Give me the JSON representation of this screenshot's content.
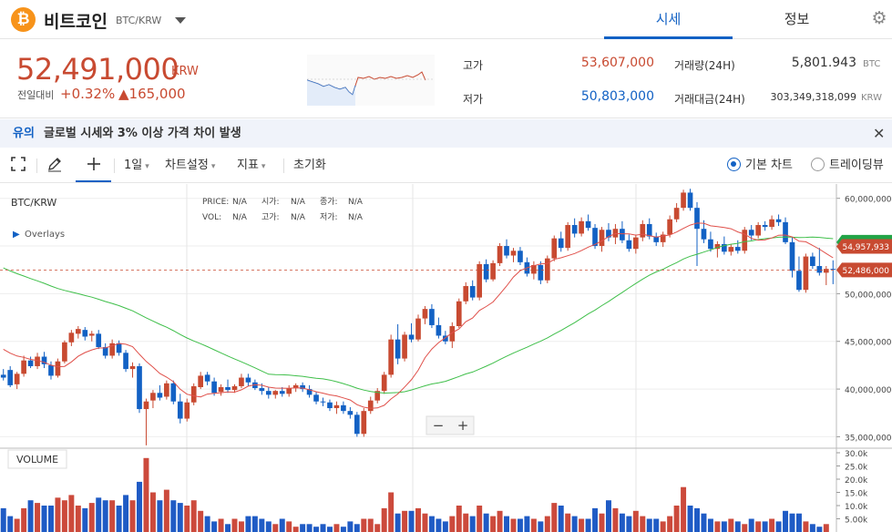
{
  "header": {
    "coin_symbol_glyph": "₿",
    "coin_name": "비트코인",
    "coin_pair": "BTC/KRW",
    "tabs": [
      {
        "label": "시세"
      },
      {
        "label": "정보"
      }
    ],
    "settings_icon": "gear-icon"
  },
  "price": {
    "current": "52,491,000",
    "unit": "KRW",
    "change_label": "전일대비",
    "change_rate": "+0.32%",
    "change_amount": "▲165,000"
  },
  "stats": {
    "high_label": "고가",
    "high_value": "53,607,000",
    "low_label": "저가",
    "low_value": "50,803,000",
    "volume_label": "거래량(24H)",
    "volume_value": "5,801.943",
    "volume_unit": "BTC",
    "amount_label": "거래대금(24H)",
    "amount_value": "303,349,318,099",
    "amount_unit": "KRW"
  },
  "notice": {
    "tag": "유의",
    "text": "글로벌 시세와 3% 이상 가격 차이 발생",
    "close_icon": "close-icon"
  },
  "toolbar": {
    "fullscreen_icon": "fullscreen-icon",
    "draw_icon": "pencil-icon",
    "crosshair_icon": "crosshair-icon",
    "interval": "1일",
    "chart_settings": "차트설정",
    "indicators": "지표",
    "reset": "초기화",
    "chart_type_basic": "기본 차트",
    "chart_type_tv": "트레이딩뷰"
  },
  "chart_data": {
    "type": "candlestick",
    "pair": "BTC/KRW",
    "overlays_label": "Overlays",
    "legend": {
      "price_label": "PRICE:",
      "price_value": "N/A",
      "open_label": "시가:",
      "open_value": "N/A",
      "close_label": "종가:",
      "close_value": "N/A",
      "vol_label": "VOL:",
      "vol_value": "N/A",
      "high_label": "고가:",
      "high_value": "N/A",
      "low_label": "저가:",
      "low_value": "N/A"
    },
    "ylim": [
      33800000,
      61500000
    ],
    "y_ticks": [
      {
        "value": 60000000,
        "label": "60,000,000"
      },
      {
        "value": 55000000,
        "label": "55,000,000"
      },
      {
        "value": 50000000,
        "label": "50,000,000"
      },
      {
        "value": 45000000,
        "label": "45,000,000"
      },
      {
        "value": 40000000,
        "label": "40,000,000"
      },
      {
        "value": 35000000,
        "label": "35,000,000"
      }
    ],
    "price_badges": [
      {
        "value": 54957933,
        "label": "54,957,933",
        "color": "#c84a31"
      },
      {
        "value": 52486000,
        "label": "52,486,000",
        "color": "#c84a31"
      },
      {
        "value": 55400000,
        "label": "",
        "color": "#22a447"
      }
    ],
    "current_price_line": 52486000,
    "candles": [
      [
        41.5,
        42.1,
        40.9,
        41.2
      ],
      [
        42.0,
        42.4,
        40.2,
        40.4
      ],
      [
        40.5,
        41.8,
        40.0,
        41.6
      ],
      [
        41.6,
        43.5,
        41.3,
        43.0
      ],
      [
        43.0,
        43.4,
        42.2,
        42.4
      ],
      [
        42.4,
        43.8,
        42.1,
        43.4
      ],
      [
        43.4,
        43.9,
        42.2,
        42.6
      ],
      [
        42.5,
        42.9,
        41.0,
        41.4
      ],
      [
        41.4,
        43.2,
        41.2,
        42.9
      ],
      [
        42.9,
        45.1,
        42.7,
        44.9
      ],
      [
        44.9,
        46.2,
        44.5,
        45.9
      ],
      [
        45.8,
        46.6,
        45.3,
        46.3
      ],
      [
        46.2,
        46.5,
        45.1,
        45.5
      ],
      [
        45.6,
        46.1,
        45.0,
        45.8
      ],
      [
        45.8,
        46.2,
        44.2,
        44.4
      ],
      [
        44.4,
        44.8,
        43.2,
        43.5
      ],
      [
        43.5,
        45.2,
        43.2,
        44.8
      ],
      [
        44.8,
        45.1,
        43.5,
        43.8
      ],
      [
        43.8,
        44.1,
        41.8,
        42.1
      ],
      [
        42.1,
        42.8,
        41.2,
        42.4
      ],
      [
        42.4,
        42.7,
        37.5,
        37.9
      ],
      [
        37.9,
        39.0,
        34.1,
        38.7
      ],
      [
        38.8,
        39.9,
        38.0,
        39.6
      ],
      [
        39.6,
        40.4,
        38.8,
        39.1
      ],
      [
        39.2,
        40.9,
        38.9,
        40.6
      ],
      [
        40.6,
        40.9,
        38.4,
        38.7
      ],
      [
        38.7,
        39.5,
        36.4,
        36.9
      ],
      [
        36.9,
        39.0,
        36.6,
        38.6
      ],
      [
        38.6,
        40.6,
        38.3,
        40.3
      ],
      [
        40.2,
        41.8,
        40.0,
        41.4
      ],
      [
        41.5,
        41.8,
        40.4,
        40.8
      ],
      [
        40.8,
        41.2,
        39.3,
        39.6
      ],
      [
        39.7,
        40.5,
        39.3,
        40.2
      ],
      [
        40.2,
        41.0,
        39.6,
        39.9
      ],
      [
        39.9,
        40.5,
        39.6,
        40.3
      ],
      [
        40.3,
        41.6,
        40.1,
        41.2
      ],
      [
        41.2,
        41.6,
        40.3,
        40.7
      ],
      [
        40.7,
        41.0,
        39.9,
        40.1
      ],
      [
        40.1,
        40.6,
        39.4,
        39.8
      ],
      [
        39.8,
        40.2,
        39.0,
        39.4
      ],
      [
        39.4,
        39.9,
        39.0,
        39.8
      ],
      [
        39.8,
        40.2,
        39.2,
        39.5
      ],
      [
        39.5,
        40.4,
        39.2,
        40.1
      ],
      [
        40.1,
        40.6,
        39.7,
        40.4
      ],
      [
        40.4,
        40.7,
        39.7,
        40.0
      ],
      [
        40.0,
        40.4,
        39.1,
        39.4
      ],
      [
        39.4,
        39.7,
        38.4,
        38.7
      ],
      [
        38.7,
        39.1,
        38.2,
        38.6
      ],
      [
        38.6,
        38.9,
        37.7,
        38.0
      ],
      [
        38.0,
        38.7,
        37.4,
        38.3
      ],
      [
        38.3,
        38.7,
        37.4,
        37.7
      ],
      [
        37.7,
        38.1,
        36.9,
        37.3
      ],
      [
        37.3,
        37.6,
        35.0,
        35.3
      ],
      [
        35.3,
        38.0,
        35.0,
        37.7
      ],
      [
        37.7,
        39.2,
        37.4,
        38.8
      ],
      [
        38.8,
        40.1,
        38.5,
        39.8
      ],
      [
        39.8,
        41.8,
        39.5,
        41.5
      ],
      [
        41.5,
        45.7,
        41.2,
        45.2
      ],
      [
        45.2,
        46.8,
        42.6,
        43.2
      ],
      [
        43.2,
        46.0,
        42.9,
        45.7
      ],
      [
        45.7,
        46.9,
        44.9,
        45.2
      ],
      [
        45.2,
        47.8,
        45.0,
        47.4
      ],
      [
        47.4,
        48.7,
        46.8,
        48.4
      ],
      [
        48.4,
        48.9,
        46.4,
        46.7
      ],
      [
        46.7,
        47.5,
        45.3,
        45.6
      ],
      [
        45.6,
        46.1,
        44.7,
        45.0
      ],
      [
        45.0,
        47.0,
        44.3,
        46.6
      ],
      [
        46.6,
        49.5,
        46.4,
        49.2
      ],
      [
        49.2,
        51.2,
        48.9,
        50.8
      ],
      [
        50.8,
        51.4,
        49.3,
        49.6
      ],
      [
        49.6,
        53.4,
        49.3,
        53.1
      ],
      [
        53.1,
        53.6,
        51.2,
        51.5
      ],
      [
        51.5,
        53.5,
        51.3,
        53.2
      ],
      [
        53.2,
        55.3,
        52.9,
        55.0
      ],
      [
        55.0,
        55.7,
        53.7,
        54.0
      ],
      [
        54.0,
        54.8,
        53.3,
        54.5
      ],
      [
        54.5,
        54.9,
        53.0,
        53.3
      ],
      [
        53.3,
        53.8,
        51.8,
        52.1
      ],
      [
        52.1,
        53.4,
        51.5,
        53.0
      ],
      [
        53.0,
        53.4,
        51.0,
        51.4
      ],
      [
        51.4,
        54.0,
        51.1,
        53.7
      ],
      [
        53.7,
        56.1,
        53.4,
        55.8
      ],
      [
        55.8,
        56.5,
        54.4,
        54.8
      ],
      [
        54.8,
        57.5,
        54.5,
        57.2
      ],
      [
        57.2,
        57.9,
        55.9,
        56.3
      ],
      [
        56.3,
        58.0,
        56.0,
        57.6
      ],
      [
        57.6,
        58.3,
        56.6,
        56.9
      ],
      [
        56.9,
        57.3,
        54.7,
        55.0
      ],
      [
        55.0,
        57.0,
        54.4,
        56.7
      ],
      [
        56.7,
        57.4,
        55.5,
        55.9
      ],
      [
        55.9,
        57.3,
        55.2,
        56.8
      ],
      [
        56.8,
        57.6,
        55.3,
        55.6
      ],
      [
        55.6,
        56.2,
        54.4,
        54.7
      ],
      [
        54.7,
        56.2,
        54.2,
        55.9
      ],
      [
        55.9,
        57.7,
        55.5,
        57.3
      ],
      [
        57.3,
        57.9,
        55.7,
        56.0
      ],
      [
        56.0,
        56.4,
        55.0,
        55.4
      ],
      [
        55.4,
        56.5,
        54.9,
        56.2
      ],
      [
        56.2,
        58.2,
        55.9,
        57.8
      ],
      [
        57.8,
        59.5,
        57.5,
        59.0
      ],
      [
        59.0,
        60.9,
        58.7,
        60.6
      ],
      [
        60.6,
        61.0,
        58.7,
        59.0
      ],
      [
        59.0,
        59.6,
        52.9,
        56.8
      ],
      [
        56.8,
        57.7,
        55.3,
        55.7
      ],
      [
        55.7,
        56.5,
        54.4,
        54.7
      ],
      [
        54.7,
        55.5,
        53.8,
        55.2
      ],
      [
        55.2,
        56.0,
        54.1,
        54.4
      ],
      [
        54.4,
        55.2,
        54.0,
        54.9
      ],
      [
        54.9,
        55.6,
        54.2,
        54.5
      ],
      [
        54.5,
        57.0,
        54.2,
        56.7
      ],
      [
        56.7,
        57.2,
        55.6,
        56.1
      ],
      [
        56.1,
        57.5,
        55.8,
        57.2
      ],
      [
        57.2,
        57.6,
        56.6,
        57.0
      ],
      [
        57.0,
        58.2,
        56.7,
        57.8
      ],
      [
        57.8,
        58.3,
        57.1,
        57.5
      ],
      [
        57.5,
        58.0,
        55.2,
        55.4
      ],
      [
        55.4,
        55.9,
        51.7,
        52.4
      ],
      [
        52.4,
        53.9,
        50.2,
        50.4
      ],
      [
        50.4,
        54.2,
        50.1,
        53.9
      ],
      [
        53.9,
        54.3,
        52.6,
        52.9
      ],
      [
        52.9,
        54.8,
        51.9,
        52.2
      ],
      [
        52.2,
        52.9,
        50.9,
        52.6
      ],
      [
        52.6,
        53.5,
        51.0,
        52.5
      ]
    ],
    "volume_label": "VOLUME",
    "volume_ylim": [
      0,
      30000
    ],
    "volume_ticks": [
      {
        "value": 30000,
        "label": "30.0k"
      },
      {
        "value": 25000,
        "label": "25.0k"
      },
      {
        "value": 20000,
        "label": "20.0k"
      },
      {
        "value": 15000,
        "label": "15.0k"
      },
      {
        "value": 10000,
        "label": "10.0k"
      },
      {
        "value": 5000,
        "label": "5.00k"
      }
    ],
    "volumes": [
      9000,
      6000,
      5000,
      9000,
      12000,
      11000,
      10000,
      10000,
      13000,
      12000,
      14000,
      10000,
      9000,
      11000,
      13000,
      12000,
      12000,
      10000,
      14000,
      12000,
      19000,
      28000,
      15000,
      12000,
      16000,
      12000,
      11000,
      10000,
      12000,
      8000,
      6000,
      4000,
      5000,
      3000,
      5000,
      4000,
      6000,
      6000,
      5000,
      4000,
      3000,
      5000,
      4000,
      2000,
      3000,
      3000,
      2000,
      3000,
      2000,
      3000,
      2000,
      4000,
      3000,
      5000,
      5000,
      3000,
      9000,
      15000,
      7000,
      8000,
      8000,
      9000,
      7000,
      6000,
      5000,
      4000,
      6000,
      10000,
      7000,
      6000,
      10000,
      7000,
      6000,
      8000,
      6000,
      5000,
      5000,
      6000,
      5000,
      4000,
      6000,
      11000,
      10000,
      7000,
      6000,
      5000,
      5000,
      9000,
      7000,
      12000,
      9000,
      7000,
      6000,
      8000,
      6000,
      5000,
      5000,
      4000,
      6000,
      10000,
      17000,
      10000,
      9000,
      7000,
      5000,
      4000,
      4000,
      5000,
      4000,
      3000,
      5000,
      4000,
      4000,
      5000,
      4000,
      8000,
      7000,
      7000,
      4000,
      3000,
      2000,
      3000
    ],
    "volume_up_color": "#cc4a3c",
    "volume_down_color": "#1f5bc5",
    "ma_short_color": "#e0504a",
    "ma_long_color": "#3fbf4a",
    "zoom_minus": "−",
    "zoom_plus": "+"
  },
  "colors": {
    "rise": "#c84a31",
    "fall": "#1261c4",
    "accent": "#1261c4"
  }
}
